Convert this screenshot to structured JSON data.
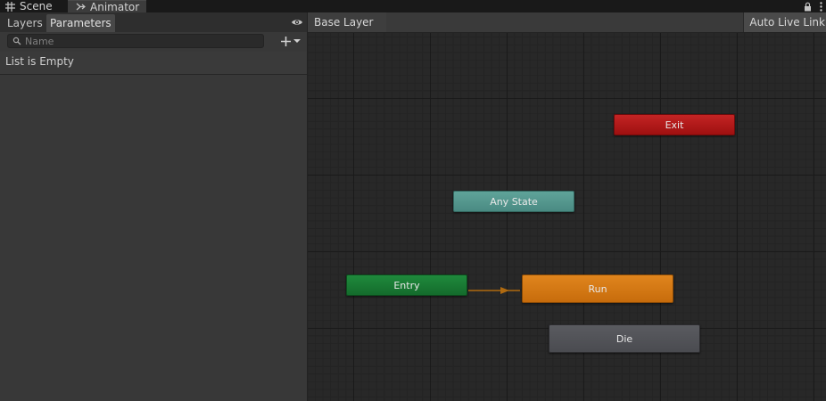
{
  "window_tabs": [
    {
      "label": "Scene",
      "icon": "grid-icon"
    },
    {
      "label": "Animator",
      "icon": "animator-icon"
    }
  ],
  "left_panel": {
    "tabs": {
      "layers": "Layers",
      "parameters": "Parameters"
    },
    "search": {
      "placeholder": "Name",
      "value": ""
    },
    "empty_text": "List is Empty"
  },
  "graph": {
    "breadcrumb": "Base Layer",
    "auto_live_link": "Auto Live Link",
    "nodes": {
      "exit": "Exit",
      "any_state": "Any State",
      "entry": "Entry",
      "run": "Run",
      "die": "Die"
    }
  },
  "colors": {
    "exit": "#b31a1a",
    "any_state": "#56978e",
    "entry": "#197a34",
    "run": "#d37815",
    "die": "#525358",
    "transition": "#b06a10"
  }
}
